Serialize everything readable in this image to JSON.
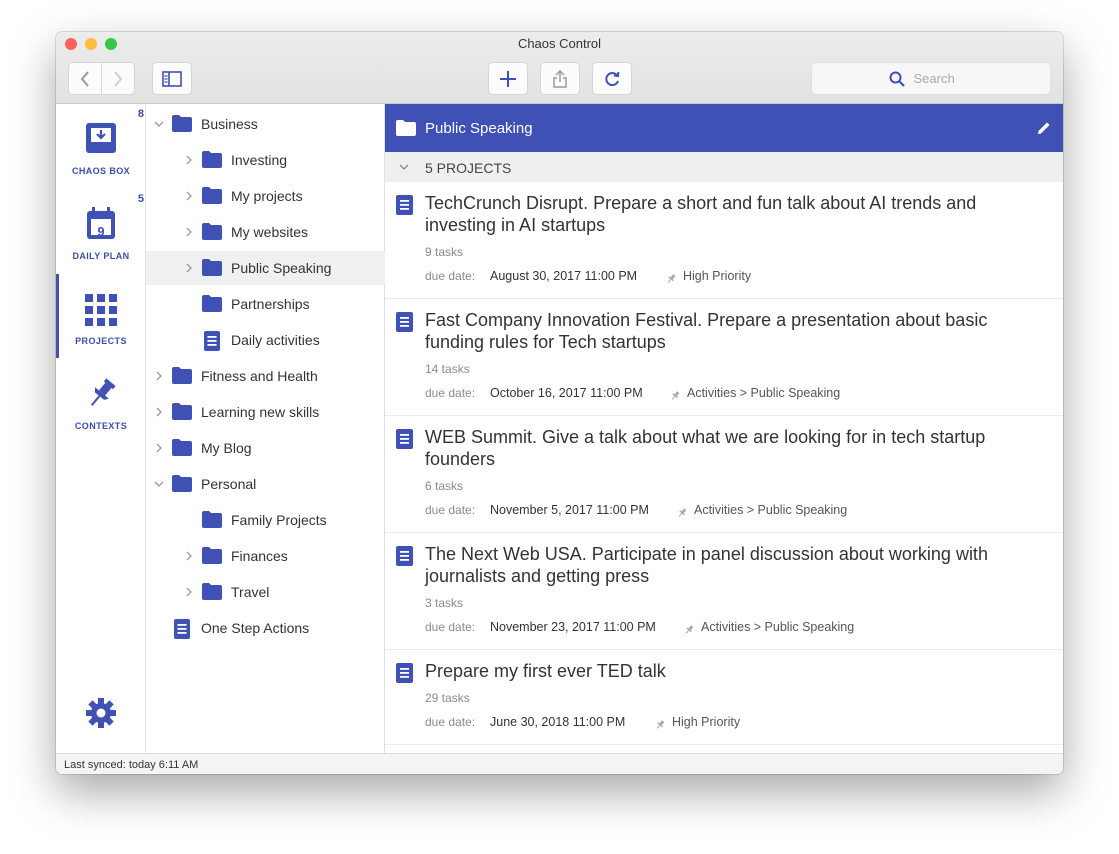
{
  "window": {
    "title": "Chaos Control"
  },
  "toolbar": {
    "search_placeholder": "Search"
  },
  "rail": {
    "items": [
      {
        "label": "CHAOS BOX",
        "badge": "8"
      },
      {
        "label": "DAILY PLAN",
        "badge": "5",
        "calendar_day": "9"
      },
      {
        "label": "PROJECTS",
        "badge": ""
      },
      {
        "label": "CONTEXTS",
        "badge": ""
      }
    ]
  },
  "tree": {
    "items": [
      {
        "label": "Business"
      },
      {
        "label": "Investing"
      },
      {
        "label": "My projects"
      },
      {
        "label": "My websites"
      },
      {
        "label": "Public Speaking"
      },
      {
        "label": "Partnerships"
      },
      {
        "label": "Daily activities"
      },
      {
        "label": "Fitness and Health"
      },
      {
        "label": "Learning new skills"
      },
      {
        "label": "My Blog"
      },
      {
        "label": "Personal"
      },
      {
        "label": "Family Projects"
      },
      {
        "label": "Finances"
      },
      {
        "label": "Travel"
      },
      {
        "label": "One Step Actions"
      }
    ]
  },
  "main": {
    "header_title": "Public Speaking",
    "count_label": "5 PROJECTS",
    "due_label": "due date:",
    "projects": [
      {
        "title": "TechCrunch Disrupt. Prepare a short and fun talk about AI trends and investing in AI startups",
        "tasks": "9 tasks",
        "due": "August 30, 2017 11:00 PM",
        "tag": "High Priority"
      },
      {
        "title": "Fast Company Innovation Festival. Prepare a presentation about basic funding rules for Tech startups",
        "tasks": "14 tasks",
        "due": "October 16, 2017 11:00 PM",
        "tag": "Activities > Public Speaking"
      },
      {
        "title": "WEB Summit. Give a talk about what we are looking for in tech startup founders",
        "tasks": "6 tasks",
        "due": "November 5, 2017 11:00 PM",
        "tag": "Activities > Public Speaking"
      },
      {
        "title": "The Next Web USA. Participate in panel discussion about working with journalists and getting press",
        "tasks": "3 tasks",
        "due": "November 23, 2017 11:00 PM",
        "tag": "Activities > Public Speaking"
      },
      {
        "title": "Prepare my first ever TED talk",
        "tasks": "29 tasks",
        "due": "June 30, 2018 11:00 PM",
        "tag": "High Priority"
      }
    ]
  },
  "footer": {
    "sync_status": "Last synced: today 6:11 AM"
  },
  "colors": {
    "accent": "#3f51b5",
    "close": "#fc605c",
    "minimize": "#fdbc40",
    "zoom": "#34c84a"
  }
}
